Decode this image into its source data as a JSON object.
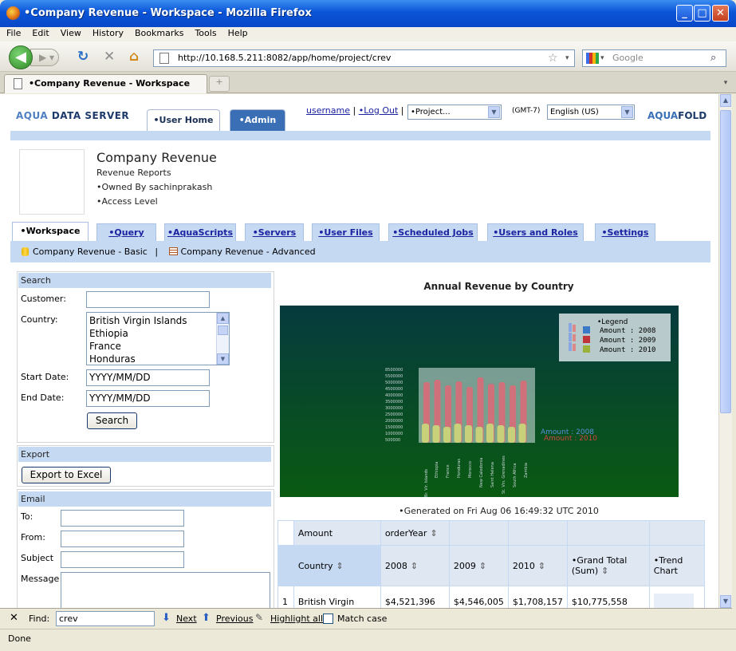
{
  "window": {
    "title": "•Company Revenue - Workspace - Mozilla Firefox"
  },
  "menu": [
    "File",
    "Edit",
    "View",
    "History",
    "Bookmarks",
    "Tools",
    "Help"
  ],
  "nav": {
    "url": "http://10.168.5.211:8082/app/home/project/crev",
    "search_placeholder": "Google"
  },
  "tab": {
    "title": "•Company Revenue - Workspace",
    "new_tab": "+"
  },
  "app": {
    "logo_left_a": "AQUA",
    "logo_left_b": " DATA SERVER",
    "logo_right_a": "AQUA",
    "logo_right_b": "FOLD",
    "tab_home": "•User Home",
    "tab_admin": "•Admin",
    "username": "username",
    "logout": "•Log Out",
    "project_select": "•Project...",
    "gmt": "(GMT-7)",
    "language": "English (US)"
  },
  "project": {
    "title": "Company Revenue",
    "subtitle": "Revenue Reports",
    "owner": "•Owned By sachinprakash",
    "access": "•Access Level"
  },
  "tabs": [
    "•Workspace",
    "•Query",
    "•AquaScripts",
    "•Servers",
    "•User Files",
    "•Scheduled Jobs",
    "•Users and Roles",
    "•Settings"
  ],
  "subtabs": {
    "basic": "Company Revenue - Basic",
    "sep": "|",
    "advanced": "Company Revenue - Advanced"
  },
  "search": {
    "header": "Search",
    "customer_label": "Customer:",
    "customer_value": "",
    "country_label": "Country:",
    "countries": [
      "British Virgin Islands",
      "Ethiopia",
      "France",
      "Honduras"
    ],
    "start_label": "Start Date:",
    "start_placeholder": "YYYY/MM/DD",
    "end_label": "End Date:",
    "end_placeholder": "YYYY/MM/DD",
    "button": "Search"
  },
  "export": {
    "header": "Export",
    "button": "Export to Excel"
  },
  "email": {
    "header": "Email",
    "to": "To:",
    "from": "From:",
    "subject": "Subject",
    "message": "Message"
  },
  "chart": {
    "heading": "Annual Revenue by Country",
    "generated": "•Generated on Fri Aug 06 16:49:32 UTC 2010",
    "overlay_2008": "Amount : 2008",
    "overlay_2010": "Amount : 2010"
  },
  "chart_data": {
    "type": "bar",
    "title": "Annual Revenue by Country",
    "legend_title": "•Legend",
    "legend_position": "top-right",
    "series": [
      {
        "name": "Amount : 2008",
        "color": "#3a78c8"
      },
      {
        "name": "Amount : 2009",
        "color": "#c0353a"
      },
      {
        "name": "Amount : 2010",
        "color": "#9ab13a"
      }
    ],
    "colors": {
      "background_top": "#063a3e",
      "background_bottom": "#0a5a12",
      "bar_2009": "#d0707a",
      "bar_2010": "#c9d07a"
    }
  },
  "table": {
    "amount": "Amount",
    "order_year": "orderYear",
    "country": "Country",
    "y2008": "2008",
    "y2009": "2009",
    "y2010": "2010",
    "grand_total": "•Grand Total (Sum)",
    "trend": "•Trend Chart",
    "rows": [
      {
        "n": "1",
        "country": "British Virgin",
        "v2008": "$4,521,396",
        "v2009": "$4,546,005",
        "v2010": "$1,708,157",
        "total": "$10,775,558"
      }
    ]
  },
  "find": {
    "close": "✕",
    "label": "Find:",
    "value": "crev",
    "next": "Next",
    "previous": "Previous",
    "highlight": "Highlight all",
    "match_case": "Match case"
  },
  "status": "Done"
}
